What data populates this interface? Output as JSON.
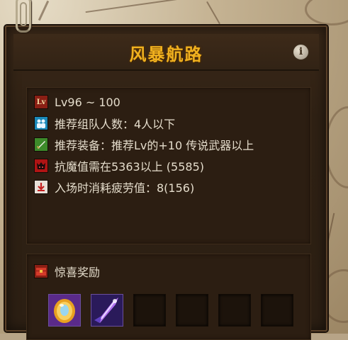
{
  "panel": {
    "title": "风暴航路",
    "info_icon_glyph": "i"
  },
  "info": {
    "rows": [
      {
        "icon": "level-icon",
        "icon_text": "Lv",
        "icon_color": "#8a1f14",
        "text": "Lv96 ~ 100"
      },
      {
        "icon": "party-members-icon",
        "icon_text": "",
        "icon_color": "#1a88b8",
        "text": "推荐组队人数：4人以下"
      },
      {
        "icon": "sword-icon",
        "icon_text": "",
        "icon_color": "#3d8a2a",
        "text": "推荐装备：推荐Lv的+10 传说武器以上"
      },
      {
        "icon": "demon-resistance-icon",
        "icon_text": "",
        "icon_color": "#b01414",
        "text": "抗魔值需在5363以上 (5585)"
      },
      {
        "icon": "fatigue-icon",
        "icon_text": "",
        "icon_color": "#c43a3a",
        "text": "入场时消耗疲劳值：8(156)"
      }
    ]
  },
  "reward": {
    "title": "惊喜奖励",
    "icon": "treasure-chest-icon",
    "slots": [
      {
        "filled": true,
        "item": "golden-orb-icon"
      },
      {
        "filled": true,
        "item": "purple-blade-icon"
      },
      {
        "filled": false
      },
      {
        "filled": false
      },
      {
        "filled": false
      },
      {
        "filled": false
      }
    ]
  }
}
